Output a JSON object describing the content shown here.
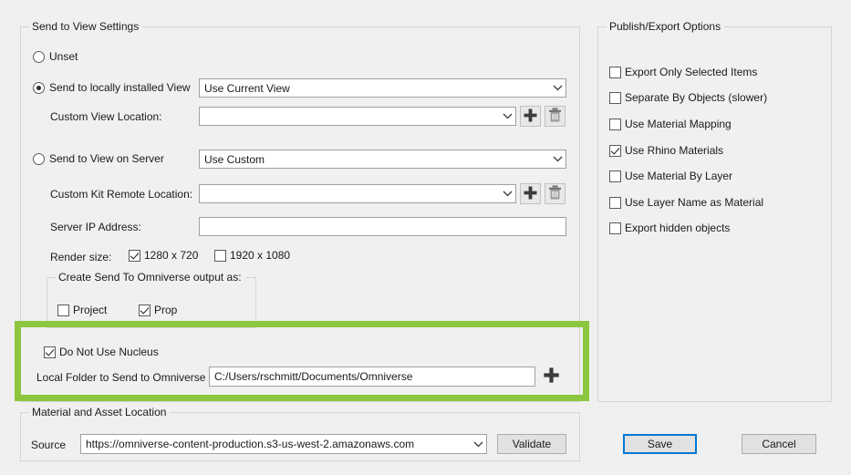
{
  "left_panel": {
    "title": "Send to View Settings",
    "radios": [
      {
        "label": "Unset",
        "checked": false
      },
      {
        "label": "Send to locally installed View",
        "checked": true
      },
      {
        "label": "Send to View on Server",
        "checked": false
      }
    ],
    "view_combo": {
      "value": "Use Current View"
    },
    "custom_view_location": {
      "label": "Custom View Location:",
      "value": ""
    },
    "server_combo": {
      "value": "Use Custom"
    },
    "custom_kit_remote_location": {
      "label": "Custom Kit Remote Location:",
      "value": ""
    },
    "server_ip_address": {
      "label": "Server IP Address:",
      "value": ""
    },
    "render_size": {
      "label": "Render size:",
      "options": [
        {
          "label": "1280 x 720",
          "checked": true
        },
        {
          "label": "1920 x 1080",
          "checked": false
        }
      ]
    },
    "output_as": {
      "title": "Create Send To Omniverse output as:",
      "options": [
        {
          "label": "Project",
          "checked": false
        },
        {
          "label": "Prop",
          "checked": true
        }
      ]
    },
    "nucleus": {
      "do_not_use_nucleus": {
        "label": "Do Not Use Nucleus",
        "checked": true
      },
      "local_folder_label": "Local Folder to Send to Omniverse",
      "local_folder_value": "C:/Users/rschmitt/Documents/Omniverse"
    },
    "icons": {
      "add": "plus-icon",
      "delete": "trash-icon",
      "dropdown": "chevron-down-icon"
    }
  },
  "right_panel": {
    "title": "Publish/Export Options",
    "checkboxes": [
      {
        "label": "Export Only Selected Items",
        "checked": false
      },
      {
        "label": "Separate By Objects (slower)",
        "checked": false
      },
      {
        "label": "Use Material Mapping",
        "checked": false
      },
      {
        "label": "Use Rhino Materials",
        "checked": true
      },
      {
        "label": "Use Material By Layer",
        "checked": false
      },
      {
        "label": "Use Layer Name as Material",
        "checked": false
      },
      {
        "label": "Export hidden objects",
        "checked": false
      }
    ]
  },
  "material_panel": {
    "title": "Material and Asset Location",
    "source_label": "Source",
    "source_value": "https://omniverse-content-production.s3-us-west-2.amazonaws.com",
    "validate_label": "Validate"
  },
  "footer": {
    "save_label": "Save",
    "cancel_label": "Cancel"
  },
  "colors": {
    "annotation_green": "#8cc63f",
    "focus_blue": "#0078d7",
    "dialog_bg": "#f0f0f0"
  }
}
